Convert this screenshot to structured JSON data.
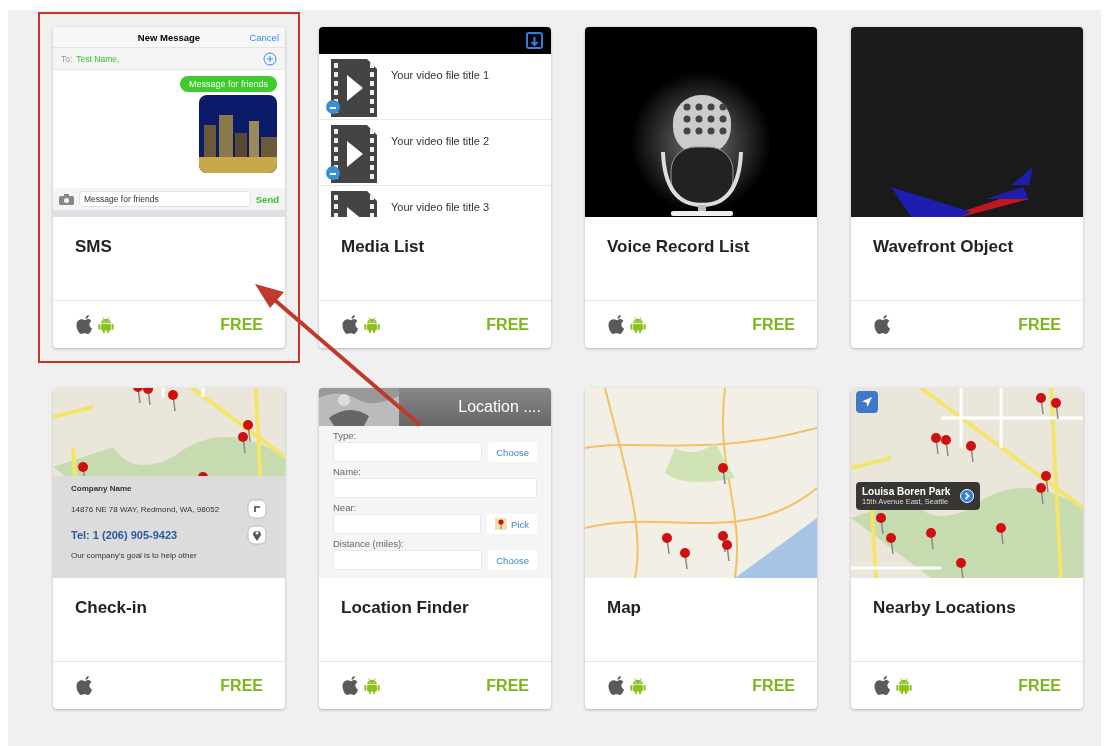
{
  "cards": [
    {
      "title": "SMS",
      "selected": true,
      "platforms": {
        "ios": true,
        "android": true
      },
      "price": "FREE",
      "thumbnail": {
        "kind": "sms",
        "title": "New Message",
        "cancel": "Cancel",
        "to_label": "To:",
        "recipient": "Test Name,",
        "bubble": "Message for friends",
        "input_value": "Message for friends",
        "send": "Send"
      }
    },
    {
      "title": "Media List",
      "selected": false,
      "platforms": {
        "ios": true,
        "android": true
      },
      "price": "FREE",
      "thumbnail": {
        "kind": "media_list",
        "items": [
          "Your video file title 1",
          "Your video file title 2",
          "Your video file title 3"
        ]
      }
    },
    {
      "title": "Voice Record List",
      "selected": false,
      "platforms": {
        "ios": true,
        "android": true
      },
      "price": "FREE"
    },
    {
      "title": "Wavefront Object",
      "selected": false,
      "platforms": {
        "ios": true,
        "android": false
      },
      "price": "FREE"
    },
    {
      "title": "Check-in",
      "selected": false,
      "platforms": {
        "ios": true,
        "android": false
      },
      "price": "FREE",
      "thumbnail": {
        "kind": "check_in",
        "company": "Company Name",
        "address": "14876 NE 78 WAY, Redmond, WA, 98052",
        "phone": "Tel: 1 (206) 905-9423",
        "description": "Our company's goal is to help other"
      }
    },
    {
      "title": "Location Finder",
      "selected": false,
      "platforms": {
        "ios": true,
        "android": true
      },
      "price": "FREE",
      "thumbnail": {
        "kind": "form",
        "header": "Location ....",
        "fields": [
          {
            "label": "Type:",
            "action": "Choose"
          },
          {
            "label": "Name:"
          },
          {
            "label": "Near:",
            "action": "Pick"
          },
          {
            "label": "Distance (miles):",
            "action": "Choose"
          }
        ]
      }
    },
    {
      "title": "Map",
      "selected": false,
      "platforms": {
        "ios": true,
        "android": true
      },
      "price": "FREE"
    },
    {
      "title": "Nearby Locations",
      "selected": false,
      "platforms": {
        "ios": true,
        "android": true
      },
      "price": "FREE",
      "thumbnail": {
        "kind": "map_callout",
        "place": "Louisa Boren Park",
        "address": "15th Avenue East, Seattle"
      }
    }
  ]
}
